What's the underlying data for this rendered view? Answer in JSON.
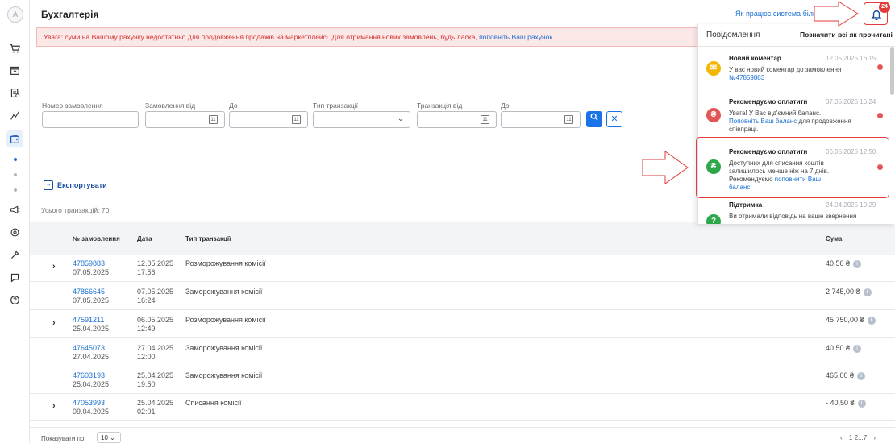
{
  "sidebar": {
    "avatar_letter": "A",
    "icons": [
      "cart-icon",
      "store-icon",
      "orders-icon",
      "analytics-icon",
      "wallet-icon",
      "promo-icon",
      "settings-icon",
      "tools-icon",
      "chat-icon",
      "help-icon"
    ]
  },
  "header": {
    "title": "Бухгалтерія",
    "help_link": "Як працює система біли"
  },
  "notifications": {
    "count": "24",
    "panel_title": "Повідомлення",
    "mark_all": "Позначити всі як прочитані",
    "items": [
      {
        "title": "Новий коментар",
        "time": "12.05.2025 16:15",
        "text": "У вас новий коментар до замовлення",
        "link": "№47859883",
        "color": "#f2b705"
      },
      {
        "title": "Рекомендуємо оплатити",
        "time": "07.05.2025 16:24",
        "text_before": "Увага! У Вас від'ємний баланс.",
        "link": "Поповніть Ваш баланс",
        "text_after": " для продовження співпраці.",
        "color": "#e45656"
      },
      {
        "title": "Рекомендуємо оплатити",
        "time": "06.05.2025 12:50",
        "text": "Доступних для списання коштів залишилось менше ніж на 7 днів. Рекомендуємо ",
        "link": "поповнити Ваш баланс.",
        "color": "#2ca84a"
      },
      {
        "title": "Підтримка",
        "time": "24.04.2025 19:29",
        "text": "Ви отримали відповідь на ваше звернення",
        "color": "#2ca84a"
      }
    ]
  },
  "alert": {
    "text": "Увага: суми на Вашому рахунку недостатньо для продовження продажів на маркетплейсі. Для отримання нових замовлень, будь ласка, ",
    "link": "поповніть Ваш рахунок."
  },
  "filters": {
    "order_number_label": "Номер замовлення",
    "order_from_label": "Замовлення від",
    "order_to_label": "До",
    "transaction_type_label": "Тип транзакції",
    "transaction_from_label": "Транзакція від",
    "transaction_to_label": "До",
    "calendar_day": "11"
  },
  "export_label": "Експортувати",
  "total_label": "Усього транзакцій: 70",
  "table": {
    "headers": {
      "order": "№ замовлення",
      "date": "Дата",
      "type": "Тип транзакції",
      "sum": "Сума"
    },
    "rows": [
      {
        "order": "47859883",
        "order_date": "07.05.2025",
        "date": "12.05.2025",
        "time": "17:56",
        "type": "Розморожування комісії",
        "sum": "40,50 ₴",
        "expandable": true
      },
      {
        "order": "47866645",
        "order_date": "07.05.2025",
        "date": "07.05.2025",
        "time": "16:24",
        "type": "Заморожування комісії",
        "sum": "2 745,00 ₴",
        "expandable": false
      },
      {
        "order": "47591211",
        "order_date": "25.04.2025",
        "date": "06.05.2025",
        "time": "12:49",
        "type": "Розморожування комісії",
        "sum": "45 750,00 ₴",
        "expandable": true
      },
      {
        "order": "47645073",
        "order_date": "27.04.2025",
        "date": "27.04.2025",
        "time": "12:00",
        "type": "Заморожування комісії",
        "sum": "40,50 ₴",
        "expandable": false
      },
      {
        "order": "47603193",
        "order_date": "25.04.2025",
        "date": "25.04.2025",
        "time": "19:50",
        "type": "Заморожування комісії",
        "sum": "465,00 ₴",
        "expandable": false
      },
      {
        "order": "47053993",
        "order_date": "09.04.2025",
        "date": "25.04.2025",
        "time": "02:01",
        "type": "Списання комісії",
        "sum": "- 40,50 ₴",
        "expandable": true
      }
    ]
  },
  "footer": {
    "per_page_label": "Показувати по:",
    "per_page_value": "10",
    "pages": "1 2...7"
  },
  "colors": {
    "accent": "#1a73e8",
    "alert_bg": "#fde8e8",
    "alert_text": "#d0302f",
    "highlight_red": "#e23b3b"
  }
}
